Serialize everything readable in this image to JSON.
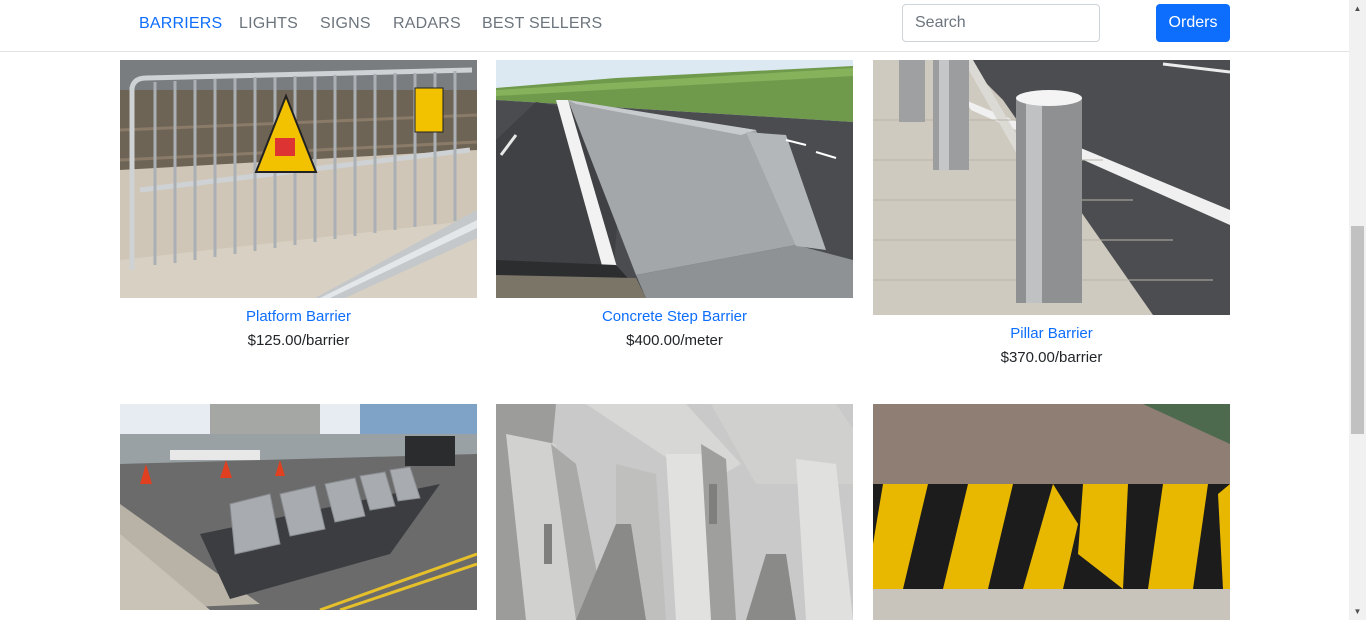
{
  "nav": {
    "items": [
      {
        "label": "BARRIERS",
        "active": true
      },
      {
        "label": "LIGHTS",
        "active": false
      },
      {
        "label": "SIGNS",
        "active": false
      },
      {
        "label": "RADARS",
        "active": false
      },
      {
        "label": "BEST SELLERS",
        "active": false
      }
    ],
    "search_placeholder": "Search",
    "orders_label": "Orders"
  },
  "products": [
    {
      "title": "Platform Barrier",
      "price": "$125.00/barrier"
    },
    {
      "title": "Concrete Step Barrier",
      "price": "$400.00/meter"
    },
    {
      "title": "Pillar Barrier",
      "price": "$370.00/barrier"
    },
    {
      "title": "",
      "price": ""
    },
    {
      "title": "",
      "price": ""
    },
    {
      "title": "",
      "price": ""
    }
  ],
  "colors": {
    "accent": "#0d6efd",
    "nav_text": "#6c757d"
  }
}
